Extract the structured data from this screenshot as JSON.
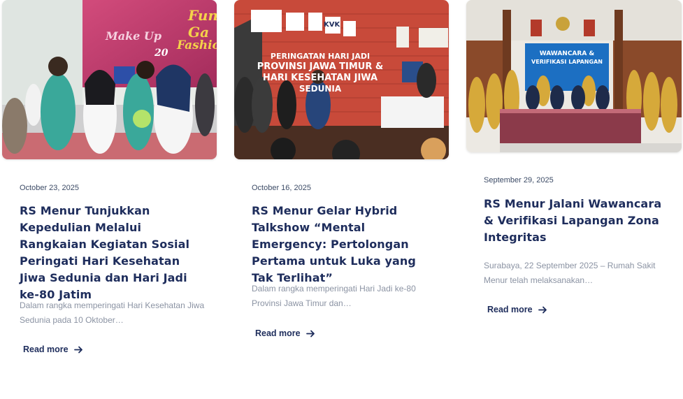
{
  "posts": [
    {
      "date": "October 23, 2025",
      "title": "RS Menur Tunjukkan Kepedulian Melalui Rangkaian Kegiatan Sosial Peringati Hari Kesehatan Jiwa Sedunia dan Hari Jadi ke-80 Jatim",
      "excerpt": "Dalam rangka memperingati Hari Kesehatan Jiwa Sedunia pada 10 Oktober…",
      "read_more": "Read more",
      "image": {
        "banner_line1": "Fun Ga",
        "banner_line2": "Make Up",
        "banner_line3": "Fashio",
        "banner_year": "20"
      }
    },
    {
      "date": "October 16, 2025",
      "title": "RS Menur Gelar Hybrid Talkshow “Mental Emergency: Pertolongan Pertama untuk Luka yang Tak Terlihat”",
      "excerpt": "Dalam rangka memperingati Hari Jadi ke-80 Provinsi Jawa Timur dan…",
      "read_more": "Read more",
      "image": {
        "wall_line1": "PERINGATAN HARI JADI",
        "wall_line2": "PROVINSI JAWA TIMUR &",
        "wall_line3": "HARI KESEHATAN JIWA",
        "wall_line4": "SEDUNIA",
        "logo_kvk": "KVK"
      }
    },
    {
      "date": "September 29, 2025",
      "title": "RS Menur Jalani Wawancara & Verifikasi Lapangan Zona Integritas",
      "excerpt": "Surabaya, 22 September 2025 – Rumah Sakit Menur telah melaksanakan…",
      "read_more": "Read more",
      "image": {
        "board_line1": "WAWANCARA &",
        "board_line2": "VERIFIKASI LAPANGAN"
      }
    }
  ],
  "icons": {
    "read_more_arrow": "arrow-right-icon"
  },
  "colors": {
    "title": "#1e2d5c",
    "date": "#3c4b66",
    "excerpt": "#8b93a3",
    "link": "#1e2d5c"
  }
}
